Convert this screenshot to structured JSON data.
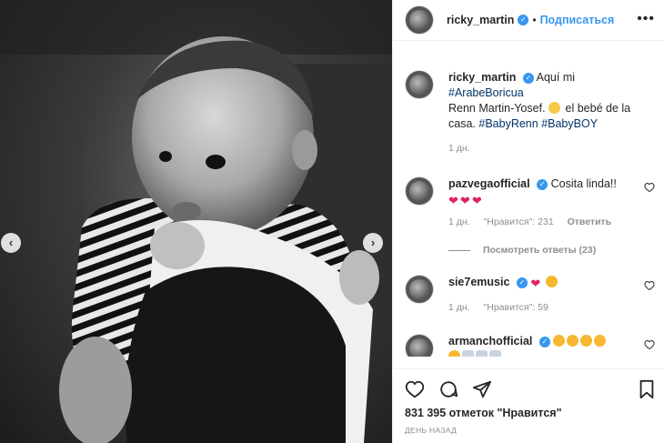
{
  "post": {
    "username": "ricky_martin",
    "follow_label": "Подписаться",
    "dot": "•",
    "more_label": "•••"
  },
  "caption": {
    "username": "ricky_martin",
    "text_pre": "Aquí mi",
    "tag1": "#ArabeBoricua",
    "text_mid": "Renn Martin-Yosef.",
    "text_after": "el bebé de la casa.",
    "tag2": "#BabyRenn",
    "tag3": "#BabyBOY",
    "time": "1 дн."
  },
  "comments": [
    {
      "username": "pazvegaofficial",
      "text": "Cosita linda!!",
      "time": "1 дн.",
      "likes": "\"Нравится\": 231",
      "reply": "Ответить",
      "view_replies": "Посмотреть ответы (23)"
    },
    {
      "username": "sie7emusic",
      "time": "1 дн.",
      "likes": "\"Нравится\": 59"
    },
    {
      "username": "armanchofficial"
    }
  ],
  "footer": {
    "likes_text": "831 395 отметок \"Нравится\"",
    "date": "ДЕНЬ НАЗАД"
  },
  "icons": {
    "prev": "‹",
    "next": "›",
    "verified": "✓",
    "heart": "❤"
  }
}
